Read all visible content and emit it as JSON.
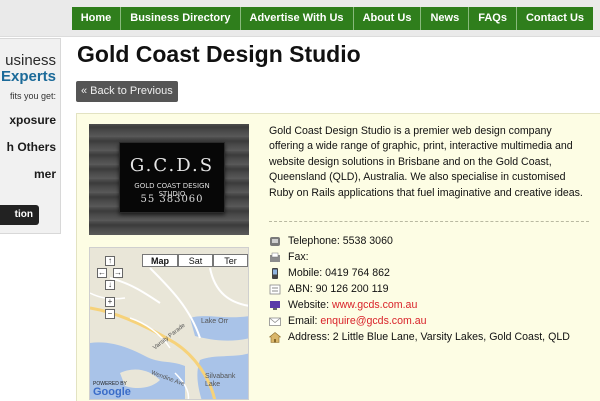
{
  "nav": {
    "items": [
      "Home",
      "Business Directory",
      "Advertise With Us",
      "About Us",
      "News",
      "FAQs",
      "Contact Us"
    ]
  },
  "sidebar": {
    "heading_line1": "usiness",
    "heading_line2": "Experts",
    "subtext": "fits you get:",
    "benefits": [
      "xposure",
      "h Others",
      "mer"
    ],
    "button_label": "tion"
  },
  "page": {
    "title": "Gold Coast Design Studio",
    "back_label": "« Back to Previous"
  },
  "photo": {
    "plaque_line1": "G.C.D.S",
    "plaque_line2": "GOLD COAST DESIGN STUDIO",
    "plaque_line3": "55 383060"
  },
  "map": {
    "buttons": [
      "Map",
      "Sat",
      "Ter"
    ],
    "labels": [
      "Lake Orr",
      "Varsity Parade",
      "Silvabank Lake",
      "Wendine Ave",
      "POWERED BY",
      "Google"
    ]
  },
  "description": "Gold Coast Design Studio is a premier web design company offering a wide range of graphic, print, interactive multimedia and website design solutions in Brisbane and on the Gold Coast, Queensland (QLD), Australia. We also specialise in customised Ruby on Rails applications that fuel imaginative and creative ideas.",
  "contacts": {
    "telephone": "Telephone: 5538 3060",
    "fax": "Fax:",
    "mobile": "Mobile: 0419 764 862",
    "abn": "ABN: 90 126 200 119",
    "website_label": "Website: ",
    "website_link": "www.gcds.com.au",
    "email_label": "Email: ",
    "email_link": "enquire@gcds.com.au",
    "address": "Address: 2 Little Blue Lane, Varsity Lakes, Gold Coast, QLD"
  },
  "colors": {
    "nav_green": "#2f7e1c",
    "panel_bg": "#fdfde4",
    "link_red": "#d9232a",
    "sidebar_blue": "#1b6a99"
  },
  "icons": [
    "telephone-icon",
    "fax-icon",
    "mobile-icon",
    "abn-icon",
    "website-icon",
    "email-icon",
    "address-icon"
  ]
}
